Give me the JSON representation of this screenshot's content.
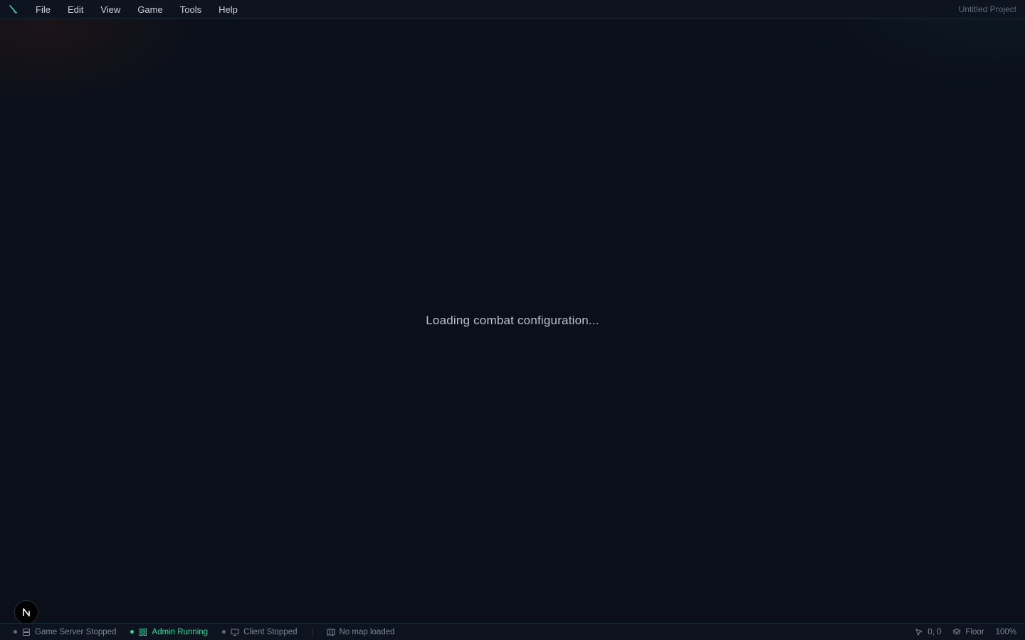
{
  "menubar": {
    "logo_icon": "brush-icon",
    "items": [
      {
        "label": "File"
      },
      {
        "label": "Edit"
      },
      {
        "label": "View"
      },
      {
        "label": "Game"
      },
      {
        "label": "Tools"
      },
      {
        "label": "Help"
      }
    ],
    "project_title": "Untitled Project"
  },
  "main": {
    "loading_text": "Loading combat configuration..."
  },
  "badge": {
    "letter": "N"
  },
  "statusbar": {
    "game_server": {
      "label": "Game Server Stopped",
      "state": "stopped",
      "icon": "server-icon"
    },
    "admin": {
      "label": "Admin Running",
      "state": "running",
      "icon": "grid-icon"
    },
    "client": {
      "label": "Client Stopped",
      "state": "stopped",
      "icon": "monitor-icon"
    },
    "map": {
      "label": "No map loaded",
      "icon": "map-icon"
    },
    "cursor": {
      "label": "0, 0",
      "icon": "cursor-icon"
    },
    "layer": {
      "label": "Floor",
      "icon": "layers-icon"
    },
    "zoom": {
      "label": "100%"
    }
  },
  "colors": {
    "background": "#0a0f1a",
    "accent": "#34d399",
    "stopped_dot": "#5f6b78"
  }
}
